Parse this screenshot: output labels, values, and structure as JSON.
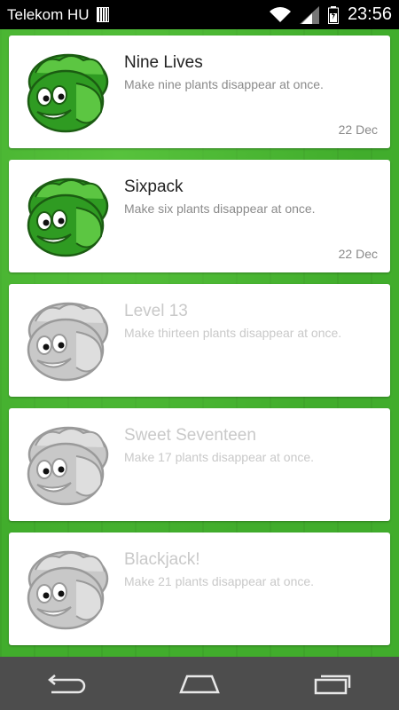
{
  "status_bar": {
    "carrier": "Telekom HU",
    "time": "23:56"
  },
  "achievements": [
    {
      "title": "Nine Lives",
      "description": "Make nine plants disappear at once.",
      "date": "22 Dec",
      "unlocked": true
    },
    {
      "title": "Sixpack",
      "description": "Make six plants disappear at once.",
      "date": "22 Dec",
      "unlocked": true
    },
    {
      "title": "Level 13",
      "description": "Make thirteen plants disappear at once.",
      "date": "",
      "unlocked": false
    },
    {
      "title": "Sweet Seventeen",
      "description": "Make 17 plants disappear at once.",
      "date": "",
      "unlocked": false
    },
    {
      "title": "Blackjack!",
      "description": "Make 21 plants disappear at once.",
      "date": "",
      "unlocked": false
    }
  ],
  "colors": {
    "background_green": "#41ad2c",
    "unlocked_leaf": "#2f9b22",
    "locked_leaf": "#c8c8c8"
  },
  "nav": {
    "back_icon": "back-icon",
    "home_icon": "home-icon",
    "recents_icon": "recent-apps-icon"
  }
}
